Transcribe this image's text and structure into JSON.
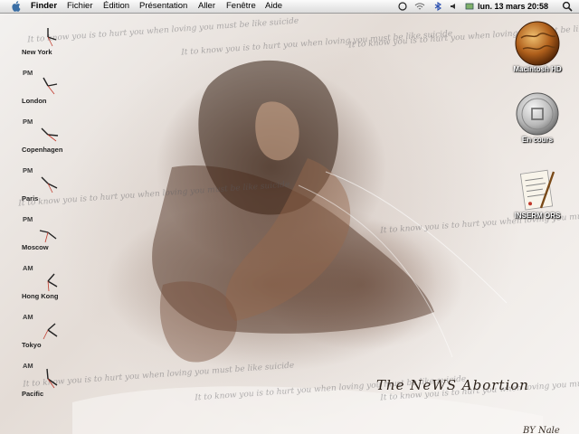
{
  "menubar": {
    "apple": "apple-icon",
    "items": [
      "Finder",
      "Fichier",
      "Édition",
      "Présentation",
      "Aller",
      "Fenêtre",
      "Aide"
    ],
    "status_icons": [
      "sync-icon",
      "wifi-icon",
      "bluetooth-icon",
      "volume-icon",
      "display-icon"
    ],
    "clock": "lun. 13 mars 20:58",
    "spotlight": "spotlight-icon"
  },
  "world_clocks": [
    {
      "ampm": "",
      "city": "New York"
    },
    {
      "ampm": "PM",
      "city": "London"
    },
    {
      "ampm": "PM",
      "city": "Copenhagen"
    },
    {
      "ampm": "PM",
      "city": "Paris"
    },
    {
      "ampm": "PM",
      "city": "Moscow"
    },
    {
      "ampm": "AM",
      "city": "Hong Kong"
    },
    {
      "ampm": "AM",
      "city": "Tokyo"
    },
    {
      "ampm": "AM",
      "city": "Pacific"
    }
  ],
  "desktop_icons": [
    {
      "label": "Macintosh HD",
      "icon": "hard-drive-globe-icon"
    },
    {
      "label": "En cours",
      "icon": "coin-icon"
    },
    {
      "label": "INSERM ORS",
      "icon": "document-pen-icon"
    }
  ],
  "wallpaper": {
    "title": "The NeWS Abortion",
    "credit": "BY Nale",
    "scribble": "It to know you is to hurt you when loving you must be like suicide"
  }
}
